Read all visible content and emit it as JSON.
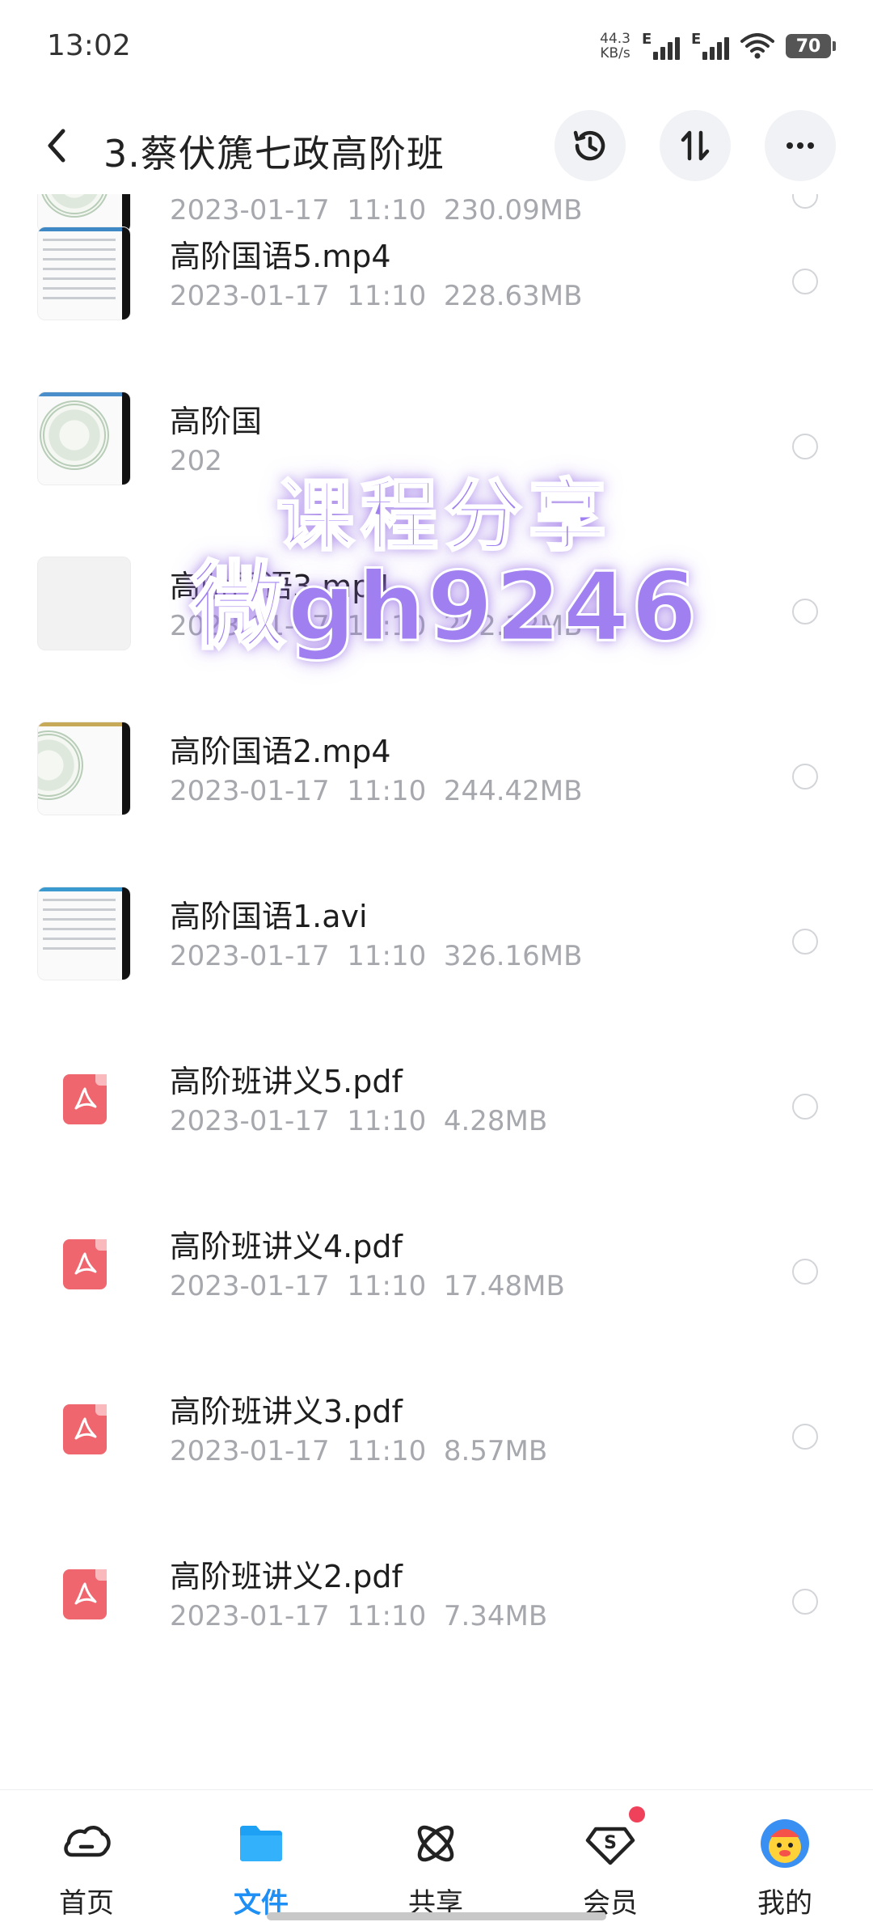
{
  "status_bar": {
    "time": "13:02",
    "net_speed_value": "44.3",
    "net_speed_unit": "KB/s",
    "signal_1_label": "E",
    "signal_2_label": "E",
    "battery": "70"
  },
  "header": {
    "title": "3.蔡伏篪七政高阶班",
    "icons": [
      "back-icon",
      "history-icon",
      "sort-icon",
      "more-icon"
    ]
  },
  "files": [
    {
      "name": "",
      "date": "2023-01-17",
      "time": "11:10",
      "size": "230.09MB",
      "type": "video"
    },
    {
      "name": "高阶国语5.mp4",
      "date": "2023-01-17",
      "time": "11:10",
      "size": "228.63MB",
      "type": "video"
    },
    {
      "name": "高阶国",
      "date": "202",
      "time": "",
      "size": "",
      "type": "video"
    },
    {
      "name": "高阶国语3.mp4",
      "date": "2023-01-17",
      "time": "11:10",
      "size": "262.12MB",
      "type": "video"
    },
    {
      "name": "高阶国语2.mp4",
      "date": "2023-01-17",
      "time": "11:10",
      "size": "244.42MB",
      "type": "video"
    },
    {
      "name": "高阶国语1.avi",
      "date": "2023-01-17",
      "time": "11:10",
      "size": "326.16MB",
      "type": "video"
    },
    {
      "name": "高阶班讲义5.pdf",
      "date": "2023-01-17",
      "time": "11:10",
      "size": "4.28MB",
      "type": "pdf"
    },
    {
      "name": "高阶班讲义4.pdf",
      "date": "2023-01-17",
      "time": "11:10",
      "size": "17.48MB",
      "type": "pdf"
    },
    {
      "name": "高阶班讲义3.pdf",
      "date": "2023-01-17",
      "time": "11:10",
      "size": "8.57MB",
      "type": "pdf"
    },
    {
      "name": "高阶班讲义2.pdf",
      "date": "2023-01-17",
      "time": "11:10",
      "size": "7.34MB",
      "type": "pdf"
    }
  ],
  "watermark": {
    "line1": "课程分享",
    "line2": "微gh9246"
  },
  "bottom_nav": {
    "items": [
      {
        "label": "首页",
        "icon": "cloud-home-icon"
      },
      {
        "label": "文件",
        "icon": "folder-icon",
        "active": true
      },
      {
        "label": "共享",
        "icon": "share-orbit-icon"
      },
      {
        "label": "会员",
        "icon": "vip-diamond-icon",
        "badge": true
      },
      {
        "label": "我的",
        "icon": "avatar-icon"
      }
    ]
  },
  "colors": {
    "accent": "#1e8ff5",
    "pdf_red": "#f0666e",
    "meta_gray": "#a6a8ad",
    "watermark_purple": "#a07ff0",
    "badge_red": "#f0415a"
  }
}
